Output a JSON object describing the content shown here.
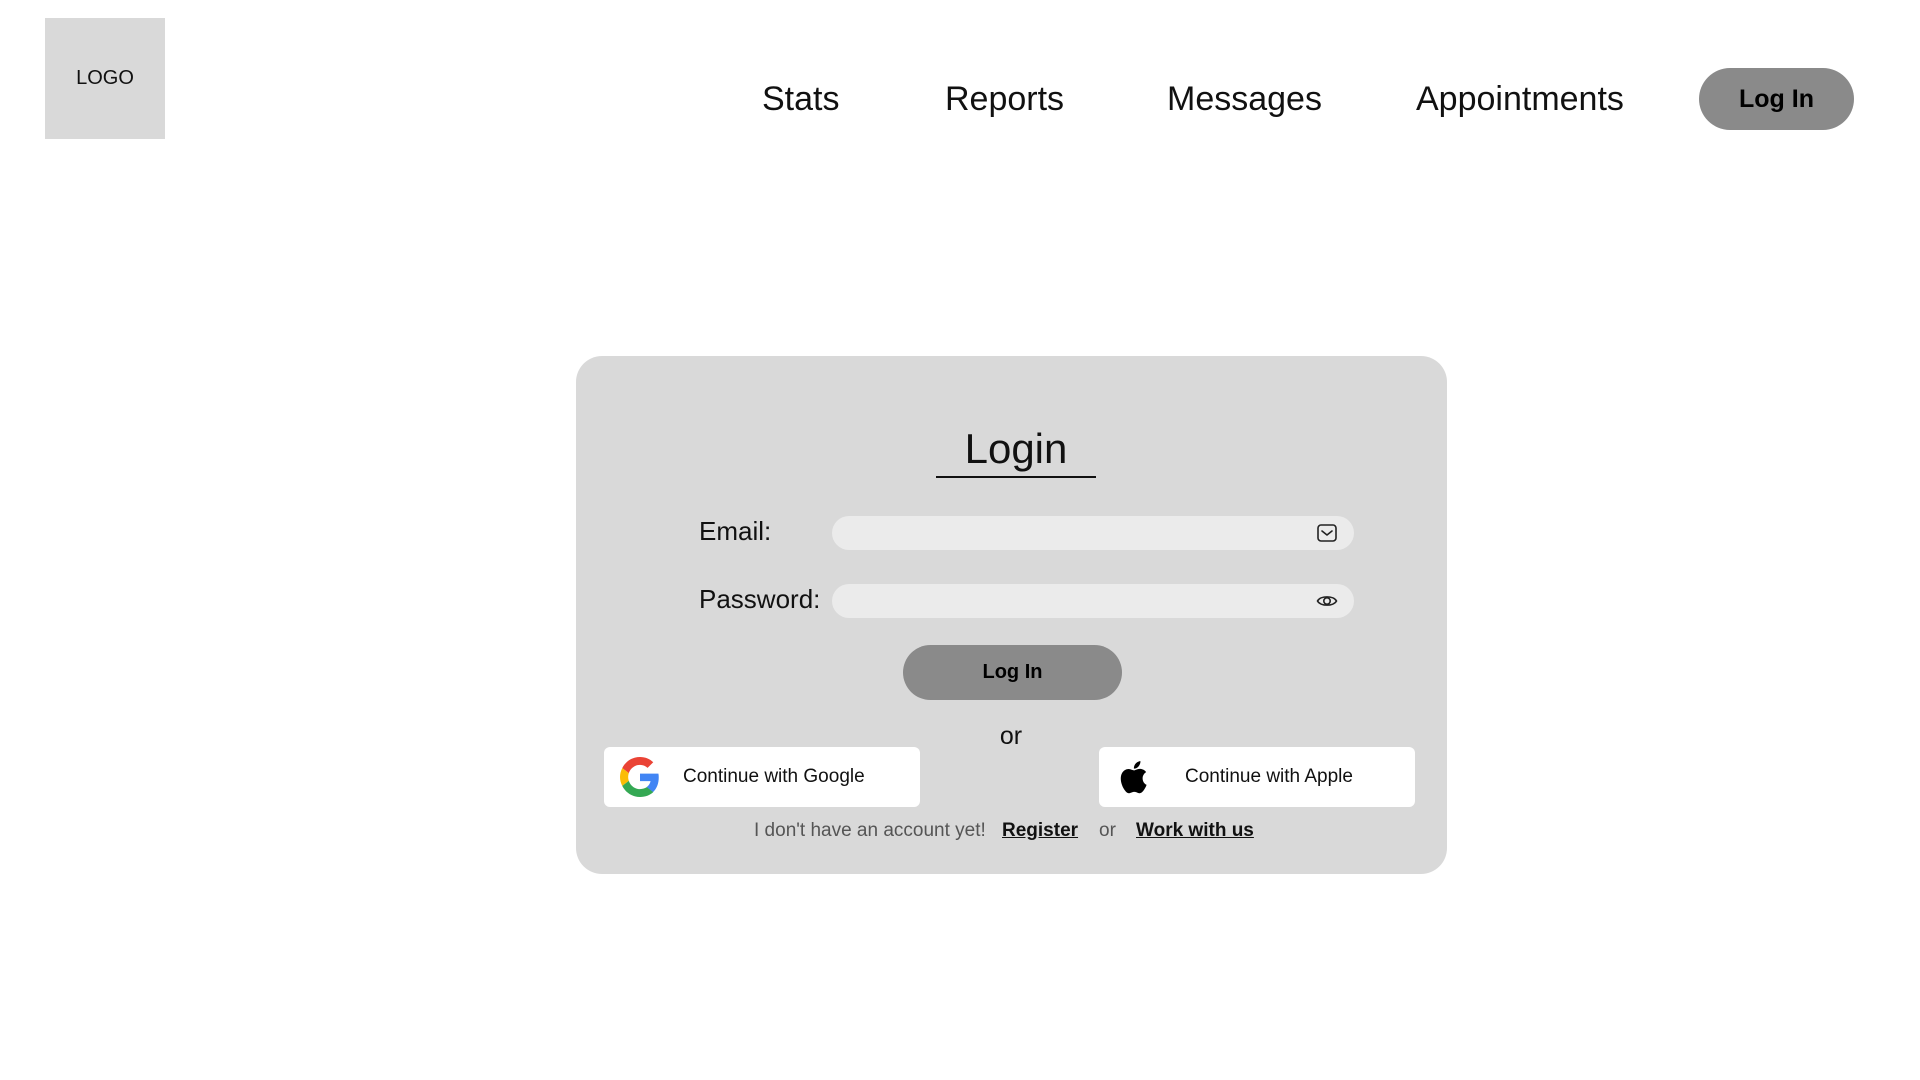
{
  "header": {
    "logo_text": "LOGO",
    "nav": [
      {
        "label": "Stats"
      },
      {
        "label": "Reports"
      },
      {
        "label": "Messages"
      },
      {
        "label": "Appointments"
      }
    ],
    "login_button": "Log In"
  },
  "login_card": {
    "title": "Login",
    "email": {
      "label": "Email:",
      "value": "",
      "placeholder": "",
      "icon": "mail-icon"
    },
    "password": {
      "label": "Password:",
      "value": "",
      "placeholder": "",
      "icon": "eye-icon"
    },
    "submit_label": "Log In",
    "divider_text": "or",
    "google": {
      "label": "Continue with Google",
      "icon": "google-icon"
    },
    "apple": {
      "label": "Continue with Apple",
      "icon": "apple-icon"
    },
    "footer": {
      "prompt": "I don't have an account yet!",
      "register_link": "Register",
      "separator": "or",
      "work_link": "Work with us"
    }
  },
  "colors": {
    "card_bg": "#d9d9d9",
    "button_bg": "#8a8a8a",
    "input_bg": "#ebebeb",
    "page_bg": "#ffffff"
  }
}
